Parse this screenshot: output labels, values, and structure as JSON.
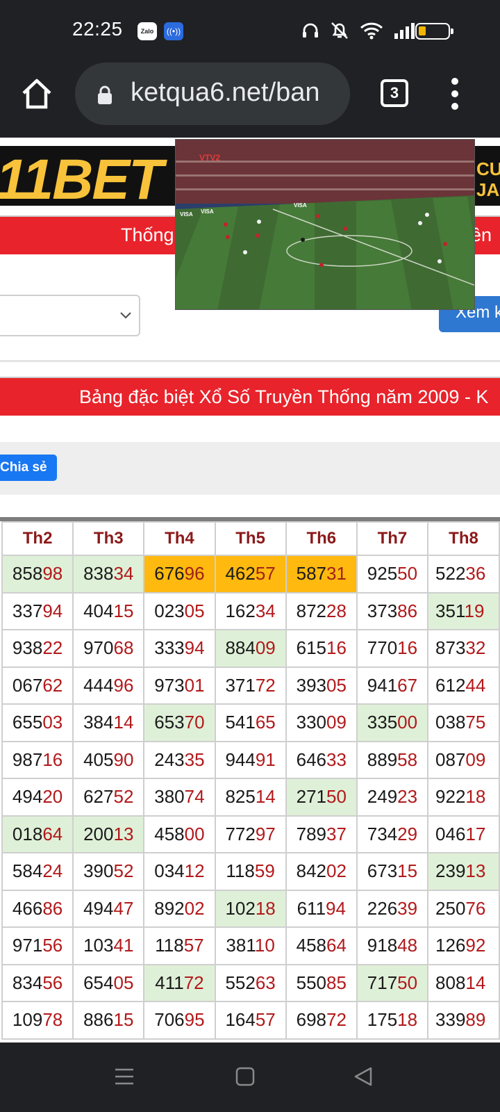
{
  "status_bar": {
    "time": "22:25",
    "zalo_label": "Zalo",
    "icons": [
      "zalo-icon",
      "cast-icon",
      "headphones-icon",
      "mute-icon",
      "wifi-icon",
      "signal-icon",
      "battery-icon"
    ],
    "battery_level": 0.2
  },
  "browser": {
    "url": "ketqua6.net/ban",
    "tab_count": "3",
    "icons": [
      "home-icon",
      "lock-icon",
      "tabs-icon",
      "more-vert-icon"
    ]
  },
  "page": {
    "banner_logo": "11BET",
    "banner_right_line1": "CU",
    "banner_right_line2": "JA",
    "red_bar_1_left": "Thống",
    "red_bar_1_right": "ền",
    "view_button_label": "Xem k",
    "red_bar_2": "Bảng đặc biệt Xổ Số Truyền Thống năm 2009 - K",
    "share_button_label": "Chia sẻ"
  },
  "video": {
    "channel_logo": "VTV2",
    "ad_text": "VISA"
  },
  "table": {
    "headers": [
      "Th2",
      "Th3",
      "Th4",
      "Th5",
      "Th6",
      "Th7",
      "Th8"
    ],
    "rows": [
      [
        {
          "h": "858",
          "t": "98",
          "s": "hl"
        },
        {
          "h": "838",
          "t": "34",
          "s": "hl"
        },
        {
          "h": "676",
          "t": "96",
          "s": "sp"
        },
        {
          "h": "462",
          "t": "57",
          "s": "sp"
        },
        {
          "h": "587",
          "t": "31",
          "s": "sp"
        },
        {
          "h": "925",
          "t": "50",
          "s": ""
        },
        {
          "h": "522",
          "t": "36",
          "s": ""
        }
      ],
      [
        {
          "h": "337",
          "t": "94",
          "s": ""
        },
        {
          "h": "404",
          "t": "15",
          "s": ""
        },
        {
          "h": "023",
          "t": "05",
          "s": ""
        },
        {
          "h": "162",
          "t": "34",
          "s": ""
        },
        {
          "h": "872",
          "t": "28",
          "s": ""
        },
        {
          "h": "373",
          "t": "86",
          "s": ""
        },
        {
          "h": "351",
          "t": "19",
          "s": "hl"
        }
      ],
      [
        {
          "h": "938",
          "t": "22",
          "s": ""
        },
        {
          "h": "970",
          "t": "68",
          "s": ""
        },
        {
          "h": "333",
          "t": "94",
          "s": ""
        },
        {
          "h": "884",
          "t": "09",
          "s": "hl"
        },
        {
          "h": "615",
          "t": "16",
          "s": ""
        },
        {
          "h": "770",
          "t": "16",
          "s": ""
        },
        {
          "h": "873",
          "t": "32",
          "s": ""
        }
      ],
      [
        {
          "h": "067",
          "t": "62",
          "s": ""
        },
        {
          "h": "444",
          "t": "96",
          "s": ""
        },
        {
          "h": "973",
          "t": "01",
          "s": ""
        },
        {
          "h": "371",
          "t": "72",
          "s": ""
        },
        {
          "h": "393",
          "t": "05",
          "s": ""
        },
        {
          "h": "941",
          "t": "67",
          "s": ""
        },
        {
          "h": "612",
          "t": "44",
          "s": ""
        }
      ],
      [
        {
          "h": "655",
          "t": "03",
          "s": ""
        },
        {
          "h": "384",
          "t": "14",
          "s": ""
        },
        {
          "h": "653",
          "t": "70",
          "s": "hl"
        },
        {
          "h": "541",
          "t": "65",
          "s": ""
        },
        {
          "h": "330",
          "t": "09",
          "s": ""
        },
        {
          "h": "335",
          "t": "00",
          "s": "hl"
        },
        {
          "h": "038",
          "t": "75",
          "s": ""
        }
      ],
      [
        {
          "h": "987",
          "t": "16",
          "s": ""
        },
        {
          "h": "405",
          "t": "90",
          "s": ""
        },
        {
          "h": "243",
          "t": "35",
          "s": ""
        },
        {
          "h": "944",
          "t": "91",
          "s": ""
        },
        {
          "h": "646",
          "t": "33",
          "s": ""
        },
        {
          "h": "889",
          "t": "58",
          "s": ""
        },
        {
          "h": "087",
          "t": "09",
          "s": ""
        }
      ],
      [
        {
          "h": "494",
          "t": "20",
          "s": ""
        },
        {
          "h": "627",
          "t": "52",
          "s": ""
        },
        {
          "h": "380",
          "t": "74",
          "s": ""
        },
        {
          "h": "825",
          "t": "14",
          "s": ""
        },
        {
          "h": "271",
          "t": "50",
          "s": "hl"
        },
        {
          "h": "249",
          "t": "23",
          "s": ""
        },
        {
          "h": "922",
          "t": "18",
          "s": ""
        }
      ],
      [
        {
          "h": "018",
          "t": "64",
          "s": "hl"
        },
        {
          "h": "200",
          "t": "13",
          "s": "hl"
        },
        {
          "h": "458",
          "t": "00",
          "s": ""
        },
        {
          "h": "772",
          "t": "97",
          "s": ""
        },
        {
          "h": "789",
          "t": "37",
          "s": ""
        },
        {
          "h": "734",
          "t": "29",
          "s": ""
        },
        {
          "h": "046",
          "t": "17",
          "s": ""
        }
      ],
      [
        {
          "h": "584",
          "t": "24",
          "s": ""
        },
        {
          "h": "390",
          "t": "52",
          "s": ""
        },
        {
          "h": "034",
          "t": "12",
          "s": ""
        },
        {
          "h": "118",
          "t": "59",
          "s": ""
        },
        {
          "h": "842",
          "t": "02",
          "s": ""
        },
        {
          "h": "673",
          "t": "15",
          "s": ""
        },
        {
          "h": "239",
          "t": "13",
          "s": "hl"
        }
      ],
      [
        {
          "h": "466",
          "t": "86",
          "s": ""
        },
        {
          "h": "494",
          "t": "47",
          "s": ""
        },
        {
          "h": "892",
          "t": "02",
          "s": ""
        },
        {
          "h": "102",
          "t": "18",
          "s": "hl"
        },
        {
          "h": "611",
          "t": "94",
          "s": ""
        },
        {
          "h": "226",
          "t": "39",
          "s": ""
        },
        {
          "h": "250",
          "t": "76",
          "s": ""
        }
      ],
      [
        {
          "h": "971",
          "t": "56",
          "s": ""
        },
        {
          "h": "103",
          "t": "41",
          "s": ""
        },
        {
          "h": "118",
          "t": "57",
          "s": ""
        },
        {
          "h": "381",
          "t": "10",
          "s": ""
        },
        {
          "h": "458",
          "t": "64",
          "s": ""
        },
        {
          "h": "918",
          "t": "48",
          "s": ""
        },
        {
          "h": "126",
          "t": "92",
          "s": ""
        }
      ],
      [
        {
          "h": "834",
          "t": "56",
          "s": ""
        },
        {
          "h": "654",
          "t": "05",
          "s": ""
        },
        {
          "h": "411",
          "t": "72",
          "s": "hl"
        },
        {
          "h": "552",
          "t": "63",
          "s": ""
        },
        {
          "h": "550",
          "t": "85",
          "s": ""
        },
        {
          "h": "717",
          "t": "50",
          "s": "hl"
        },
        {
          "h": "808",
          "t": "14",
          "s": ""
        }
      ],
      [
        {
          "h": "109",
          "t": "78",
          "s": ""
        },
        {
          "h": "886",
          "t": "15",
          "s": ""
        },
        {
          "h": "706",
          "t": "95",
          "s": ""
        },
        {
          "h": "164",
          "t": "57",
          "s": ""
        },
        {
          "h": "698",
          "t": "72",
          "s": ""
        },
        {
          "h": "175",
          "t": "18",
          "s": ""
        },
        {
          "h": "339",
          "t": "89",
          "s": ""
        }
      ]
    ]
  },
  "nav": {
    "icons": [
      "recents-icon",
      "home-nav-icon",
      "back-icon"
    ]
  },
  "colors": {
    "system_bar": "#202124",
    "red_bar": "#e8232b",
    "highlight_green": "#dff0d8",
    "highlight_orange": "#ffb90f",
    "tail_digits": "#b2191b",
    "header_text": "#8b1a1a",
    "share_blue": "#1877f2"
  }
}
